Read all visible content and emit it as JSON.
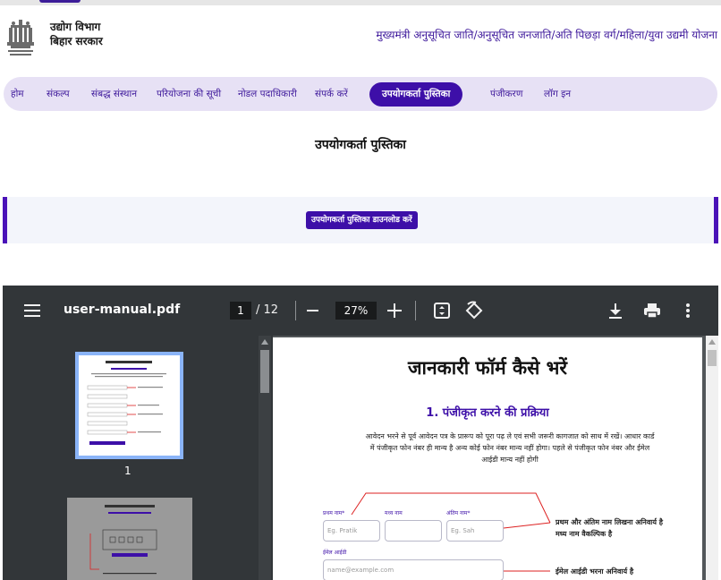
{
  "header": {
    "dept_line1": "उद्योग विभाग",
    "dept_line2": "बिहार सरकार",
    "scheme_title": "मुख्यमंत्री अनुसूचित जाति/अनुसूचित जनजाति/अति पिछड़ा वर्ग/महिला/युवा उद्यमी योजना"
  },
  "nav": {
    "items": [
      {
        "label": "होम"
      },
      {
        "label": "संकल्प"
      },
      {
        "label": "संबद्ध संस्थान"
      },
      {
        "label": "परियोजना की सूची"
      },
      {
        "label": "नोडल पदाधिकारी"
      },
      {
        "label": "संपर्क करें"
      },
      {
        "label": "उपयोगकर्ता पुस्तिका",
        "active": true
      },
      {
        "label": "पंजीकरण"
      },
      {
        "label": "लॉग इन"
      }
    ]
  },
  "page": {
    "title": "उपयोगकर्ता पुस्तिका",
    "download_label": "उपयोगकर्ता पुस्तिका डाउनलोड करें"
  },
  "viewer": {
    "file_name": "user-manual.pdf",
    "current_page": "1",
    "total_pages": "/ 12",
    "zoom": "27%",
    "thumb_number": "1",
    "icons": [
      "menu-icon",
      "zoom-out-icon",
      "zoom-in-icon",
      "fit-page-icon",
      "rotate-icon",
      "download-icon",
      "print-icon",
      "more-icon"
    ]
  },
  "doc": {
    "heading": "जानकारी फॉर्म कैसे भरें",
    "subheading": "1. पंजीकृत करने की प्रक्रिया",
    "paragraph": "आवेदन भरने से पूर्व आवेदन पत्र के प्रारूप को पूरा पढ़ ले एवं सभी जरूरी कागजात को साथ में रखें। आधार कार्ड में पंजीकृत फोन नंबर ही मान्य है अन्य कोई फोन नंबर मान्य नहीं होगा। पहले से पंजीकृत फोन नंबर और ईमेल आईडी मान्य नहीं होगी",
    "label_first": "प्रथम नाम*",
    "label_middle": "मध्य नाम",
    "label_last": "अंतिम नाम*",
    "placeholder_first": "Eg. Pratik",
    "placeholder_last": "Eg. Sah",
    "label_email": "ईमेल आईडी",
    "placeholder_email": "name@example.com",
    "note_name_1": "प्रथम और अंतिम नाम लिखना अनिवार्य है",
    "note_name_2": "मध्य नाम वैकल्पिक है",
    "note_email": "ईमेल आईडी भरना अनिवार्य है"
  },
  "colors": {
    "brand_purple": "#3d0fa8",
    "nav_bg": "#e7e1f5",
    "viewer_toolbar": "#323639"
  }
}
